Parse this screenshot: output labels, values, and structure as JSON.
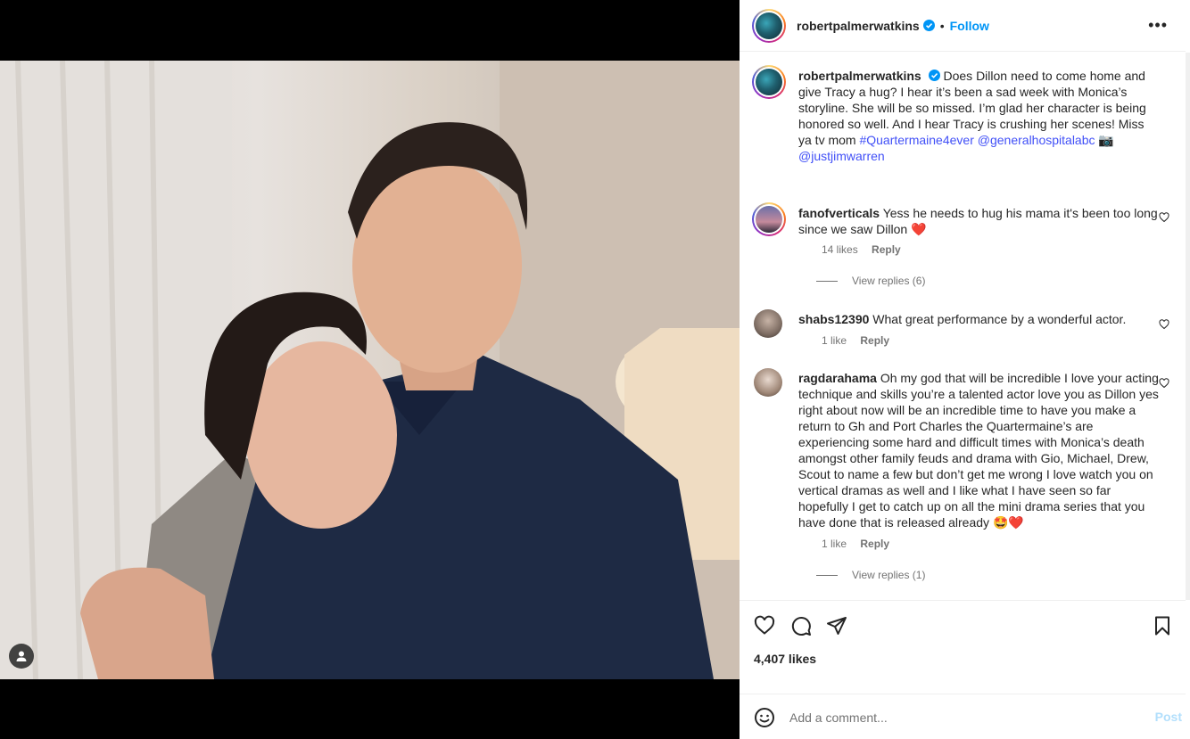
{
  "post": {
    "username": "robertpalmerwatkins",
    "follow_label": "Follow",
    "separator": "•",
    "more_label": "•••",
    "caption": {
      "username": "robertpalmerwatkins",
      "text": "Does Dillon need to come home and give Tracy a hug? I hear it’s been a sad week with Monica’s storyline. She will be so missed. I’m glad her character is being honored so well. And I hear Tracy is crushing her scenes! Miss ya tv mom",
      "hashtag": "#Quartermaine4ever",
      "mention1": "@generalhospitalabc",
      "camera_emoji": "📷",
      "mention2": "@justjimwarren"
    },
    "likes": "4,407 likes"
  },
  "comments": [
    {
      "username": "fanofverticals",
      "text": "Yess he needs to hug his mama it's been too long since we saw Dillon",
      "emoji": "❤️",
      "likes": "14 likes",
      "reply_label": "Reply",
      "view_replies": "View replies (6)"
    },
    {
      "username": "shabs12390",
      "text": "What great performance by a wonderful actor.",
      "likes": "1 like",
      "reply_label": "Reply"
    },
    {
      "username": "ragdarahama",
      "text": "Oh my god that will be incredible I love your acting technique and skills you’re a talented actor love you as Dillon yes right about now will be an incredible time to have you make a return to Gh and Port Charles the Quartermaine’s are experiencing some hard and difficult times with Monica’s death amongst other family feuds and drama with Gio, Michael, Drew, Scout to name a few but don’t get me wrong I love watch you on vertical dramas as well and I like what I have seen so far hopefully I get to catch up on all the mini drama series that you have done that is released already",
      "emoji": "🤩❤️",
      "likes": "1 like",
      "reply_label": "Reply",
      "view_replies": "View replies (1)"
    }
  ],
  "comment_box": {
    "placeholder": "Add a comment...",
    "post_label": "Post"
  },
  "icons": {
    "heart": "heart-icon",
    "comment": "comment-icon",
    "share": "share-icon",
    "save": "bookmark-icon",
    "emoji": "emoji-icon",
    "tag": "person-tag-icon",
    "verified": "verified-badge-icon"
  },
  "colors": {
    "link": "#4150f7",
    "follow": "#0095f6",
    "verified": "#0095f6",
    "heart_red": "#ed1f37",
    "post_disabled": "#b2dffc"
  }
}
